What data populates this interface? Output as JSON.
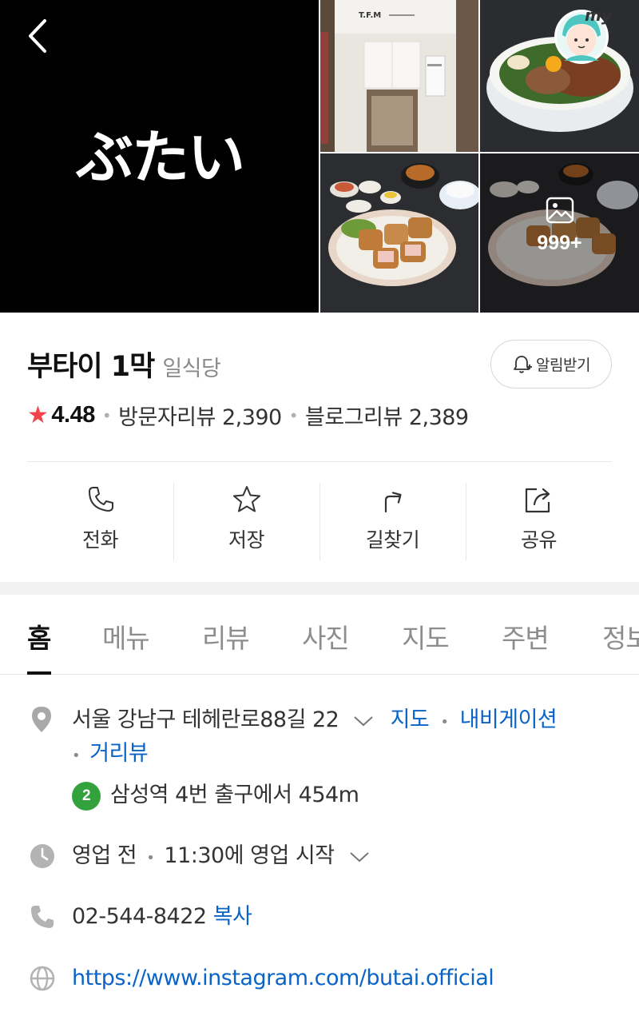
{
  "gallery": {
    "logo_text": "ぶたい",
    "photo_1_sign": "T.F.M",
    "more_count": "999+"
  },
  "header": {
    "my_badge": "my"
  },
  "place": {
    "name": "부타이 1막",
    "category": "일식당",
    "alert_label": "알림받기",
    "rating": "4.48",
    "visitor_reviews": "방문자리뷰 2,390",
    "blog_reviews": "블로그리뷰 2,389"
  },
  "actions": [
    {
      "label": "전화",
      "icon": "phone-icon"
    },
    {
      "label": "저장",
      "icon": "star-icon"
    },
    {
      "label": "길찾기",
      "icon": "directions-icon"
    },
    {
      "label": "공유",
      "icon": "share-icon"
    }
  ],
  "tabs": [
    "홈",
    "메뉴",
    "리뷰",
    "사진",
    "지도",
    "주변",
    "정보"
  ],
  "info": {
    "address": "서울 강남구 테헤란로88길 22",
    "map_link": "지도",
    "navigation_link": "내비게이션",
    "roadview_link": "거리뷰",
    "subway_line": "2",
    "subway_text": "삼성역 4번 출구에서 454m",
    "hours_status": "영업 전",
    "hours_text": "11:30에 영업 시작",
    "phone": "02-544-8422",
    "copy_label": "복사",
    "website": "https://www.instagram.com/butai.official"
  },
  "colors": {
    "star": "#f2434a",
    "link": "#0a64c8",
    "subway_line_2": "#33a23d"
  }
}
